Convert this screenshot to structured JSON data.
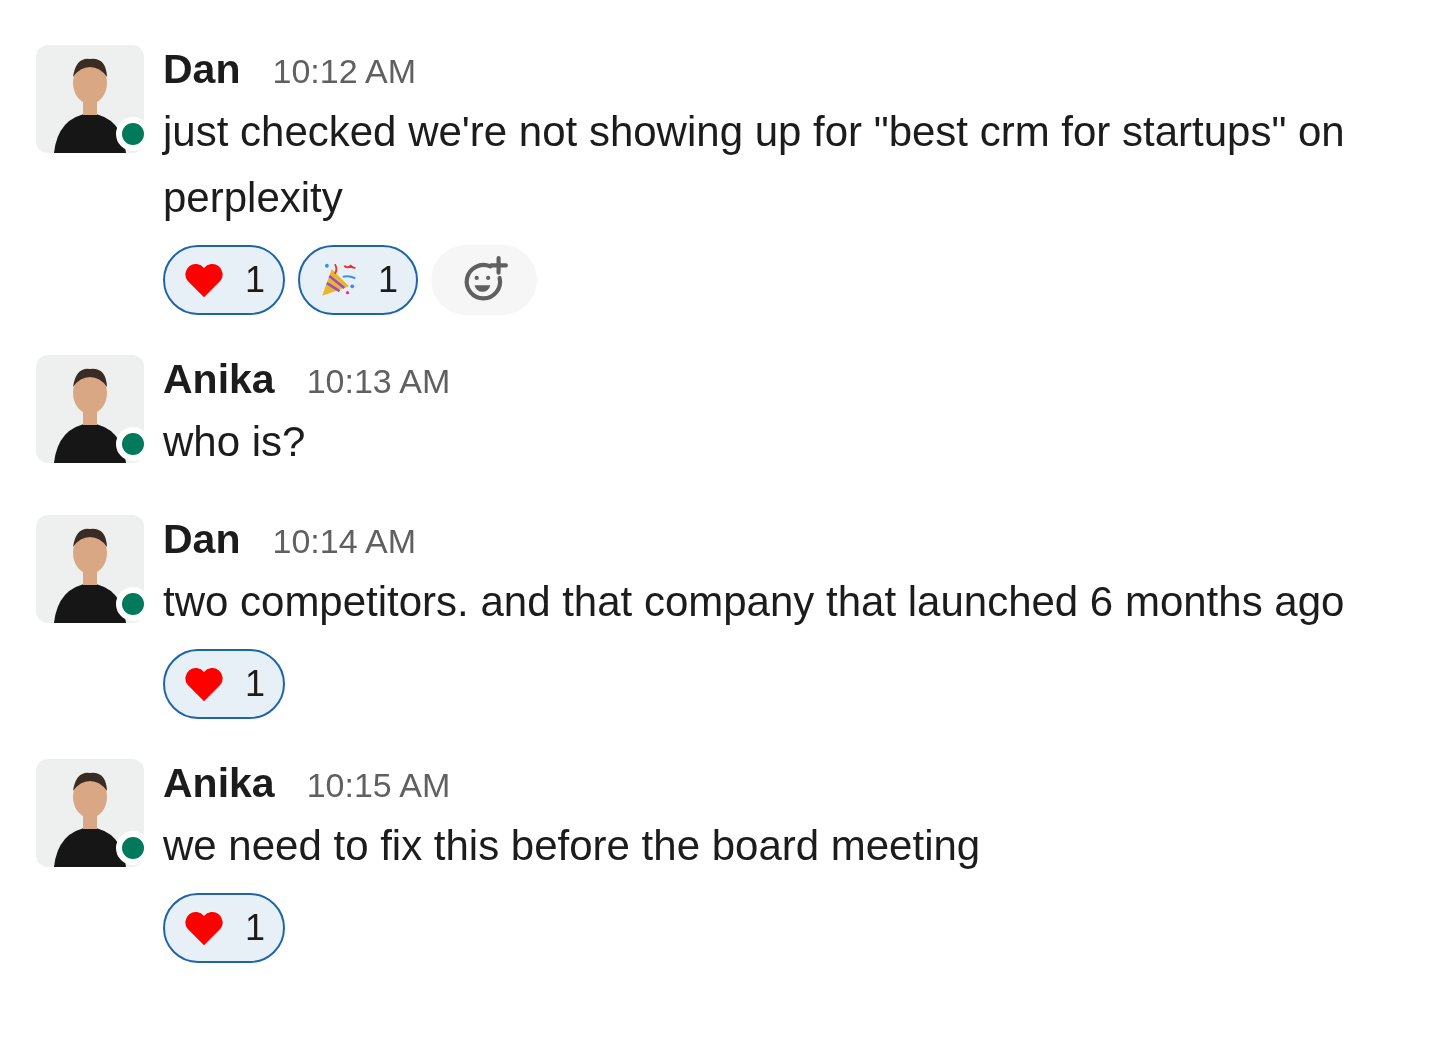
{
  "messages": [
    {
      "author": "Dan",
      "time": "10:12 AM",
      "online": true,
      "text": "just checked we're not showing up for \"best crm for startups\" on perplexity",
      "reactions": [
        {
          "kind": "heart",
          "count": "1",
          "selected": true
        },
        {
          "kind": "party",
          "count": "1",
          "selected": true
        }
      ],
      "add_reaction": true
    },
    {
      "author": "Anika",
      "time": "10:13 AM",
      "online": true,
      "text": "who is?"
    },
    {
      "author": "Dan",
      "time": "10:14 AM",
      "online": true,
      "text": "two competitors. and that company that launched 6 months ago",
      "reactions": [
        {
          "kind": "heart",
          "count": "1",
          "selected": true
        }
      ]
    },
    {
      "author": "Anika",
      "time": "10:15 AM",
      "online": true,
      "text": "we need to fix this before the board meeting",
      "reactions": [
        {
          "kind": "heart",
          "count": "1",
          "selected": true
        }
      ]
    }
  ]
}
